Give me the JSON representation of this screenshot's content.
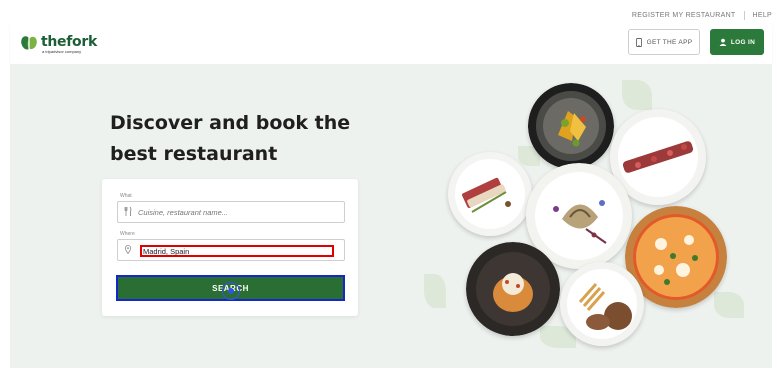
{
  "topbar": {
    "register_label": "REGISTER MY RESTAURANT",
    "help_label": "HELP"
  },
  "header": {
    "logo_text": "thefork",
    "logo_subtext": "a tripadvisor company",
    "app_button_label": "GET THE APP",
    "login_button_label": "LOG IN"
  },
  "hero": {
    "headline": "Discover and book the best restaurant"
  },
  "search": {
    "what_label": "What",
    "what_placeholder": "Cuisine, restaurant name...",
    "where_label": "Where",
    "where_value": "Madrid, Spain",
    "search_button_label": "SEARCH"
  },
  "icons": {
    "app": "phone-icon",
    "login": "user-icon",
    "what": "cutlery-icon",
    "where": "location-pin-icon"
  },
  "colors": {
    "brand_green": "#2b7a3c",
    "search_button": "#2b6e33",
    "hero_bg": "#eef2ef",
    "highlight_red": "#e00000",
    "highlight_blue": "#1427c8"
  }
}
